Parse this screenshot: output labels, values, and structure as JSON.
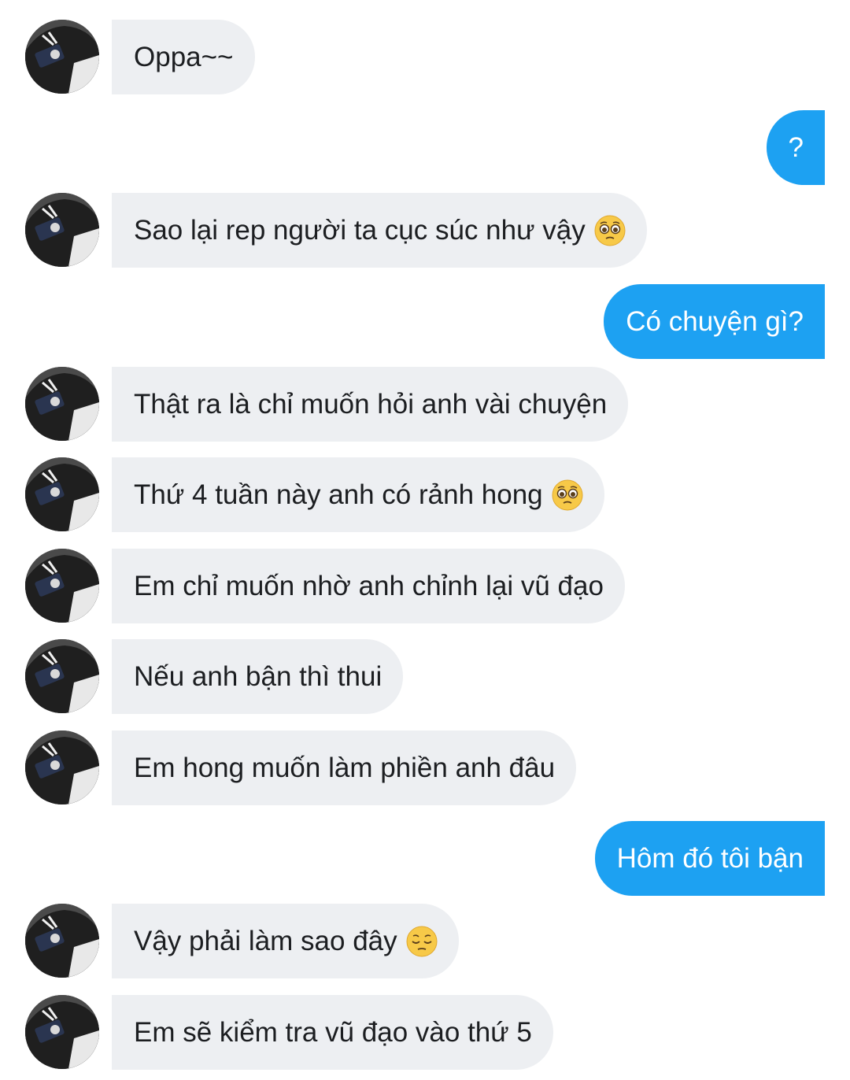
{
  "conversation": {
    "messages": [
      {
        "sender": "other",
        "text": "Oppa~~",
        "emoji": ""
      },
      {
        "sender": "me",
        "text": "?",
        "emoji": ""
      },
      {
        "sender": "other",
        "text": "Sao lại rep người ta cục súc như vậy",
        "emoji": "pleading-face-icon"
      },
      {
        "sender": "me",
        "text": "Có chuyện gì?",
        "emoji": ""
      },
      {
        "sender": "other",
        "text": "Thật ra là chỉ muốn hỏi anh vài chuyện",
        "emoji": ""
      },
      {
        "sender": "other",
        "text": "Thứ 4 tuần này anh có rảnh hong",
        "emoji": "pleading-face-icon"
      },
      {
        "sender": "other",
        "text": "Em chỉ muốn nhờ anh chỉnh lại vũ đạo",
        "emoji": ""
      },
      {
        "sender": "other",
        "text": "Nếu anh bận thì thui",
        "emoji": ""
      },
      {
        "sender": "other",
        "text": "Em hong muốn làm phiền anh đâu",
        "emoji": ""
      },
      {
        "sender": "me",
        "text": "Hôm đó tôi bận",
        "emoji": ""
      },
      {
        "sender": "other",
        "text": "Vậy phải làm sao đây",
        "emoji": "pensive-face-icon"
      },
      {
        "sender": "other",
        "text": "Em sẽ kiểm tra vũ đạo vào thứ 5",
        "emoji": ""
      }
    ]
  },
  "colors": {
    "incoming_bubble": "#edeff2",
    "outgoing_bubble": "#1da1f2",
    "incoming_text": "#1c1e21",
    "outgoing_text": "#ffffff"
  }
}
